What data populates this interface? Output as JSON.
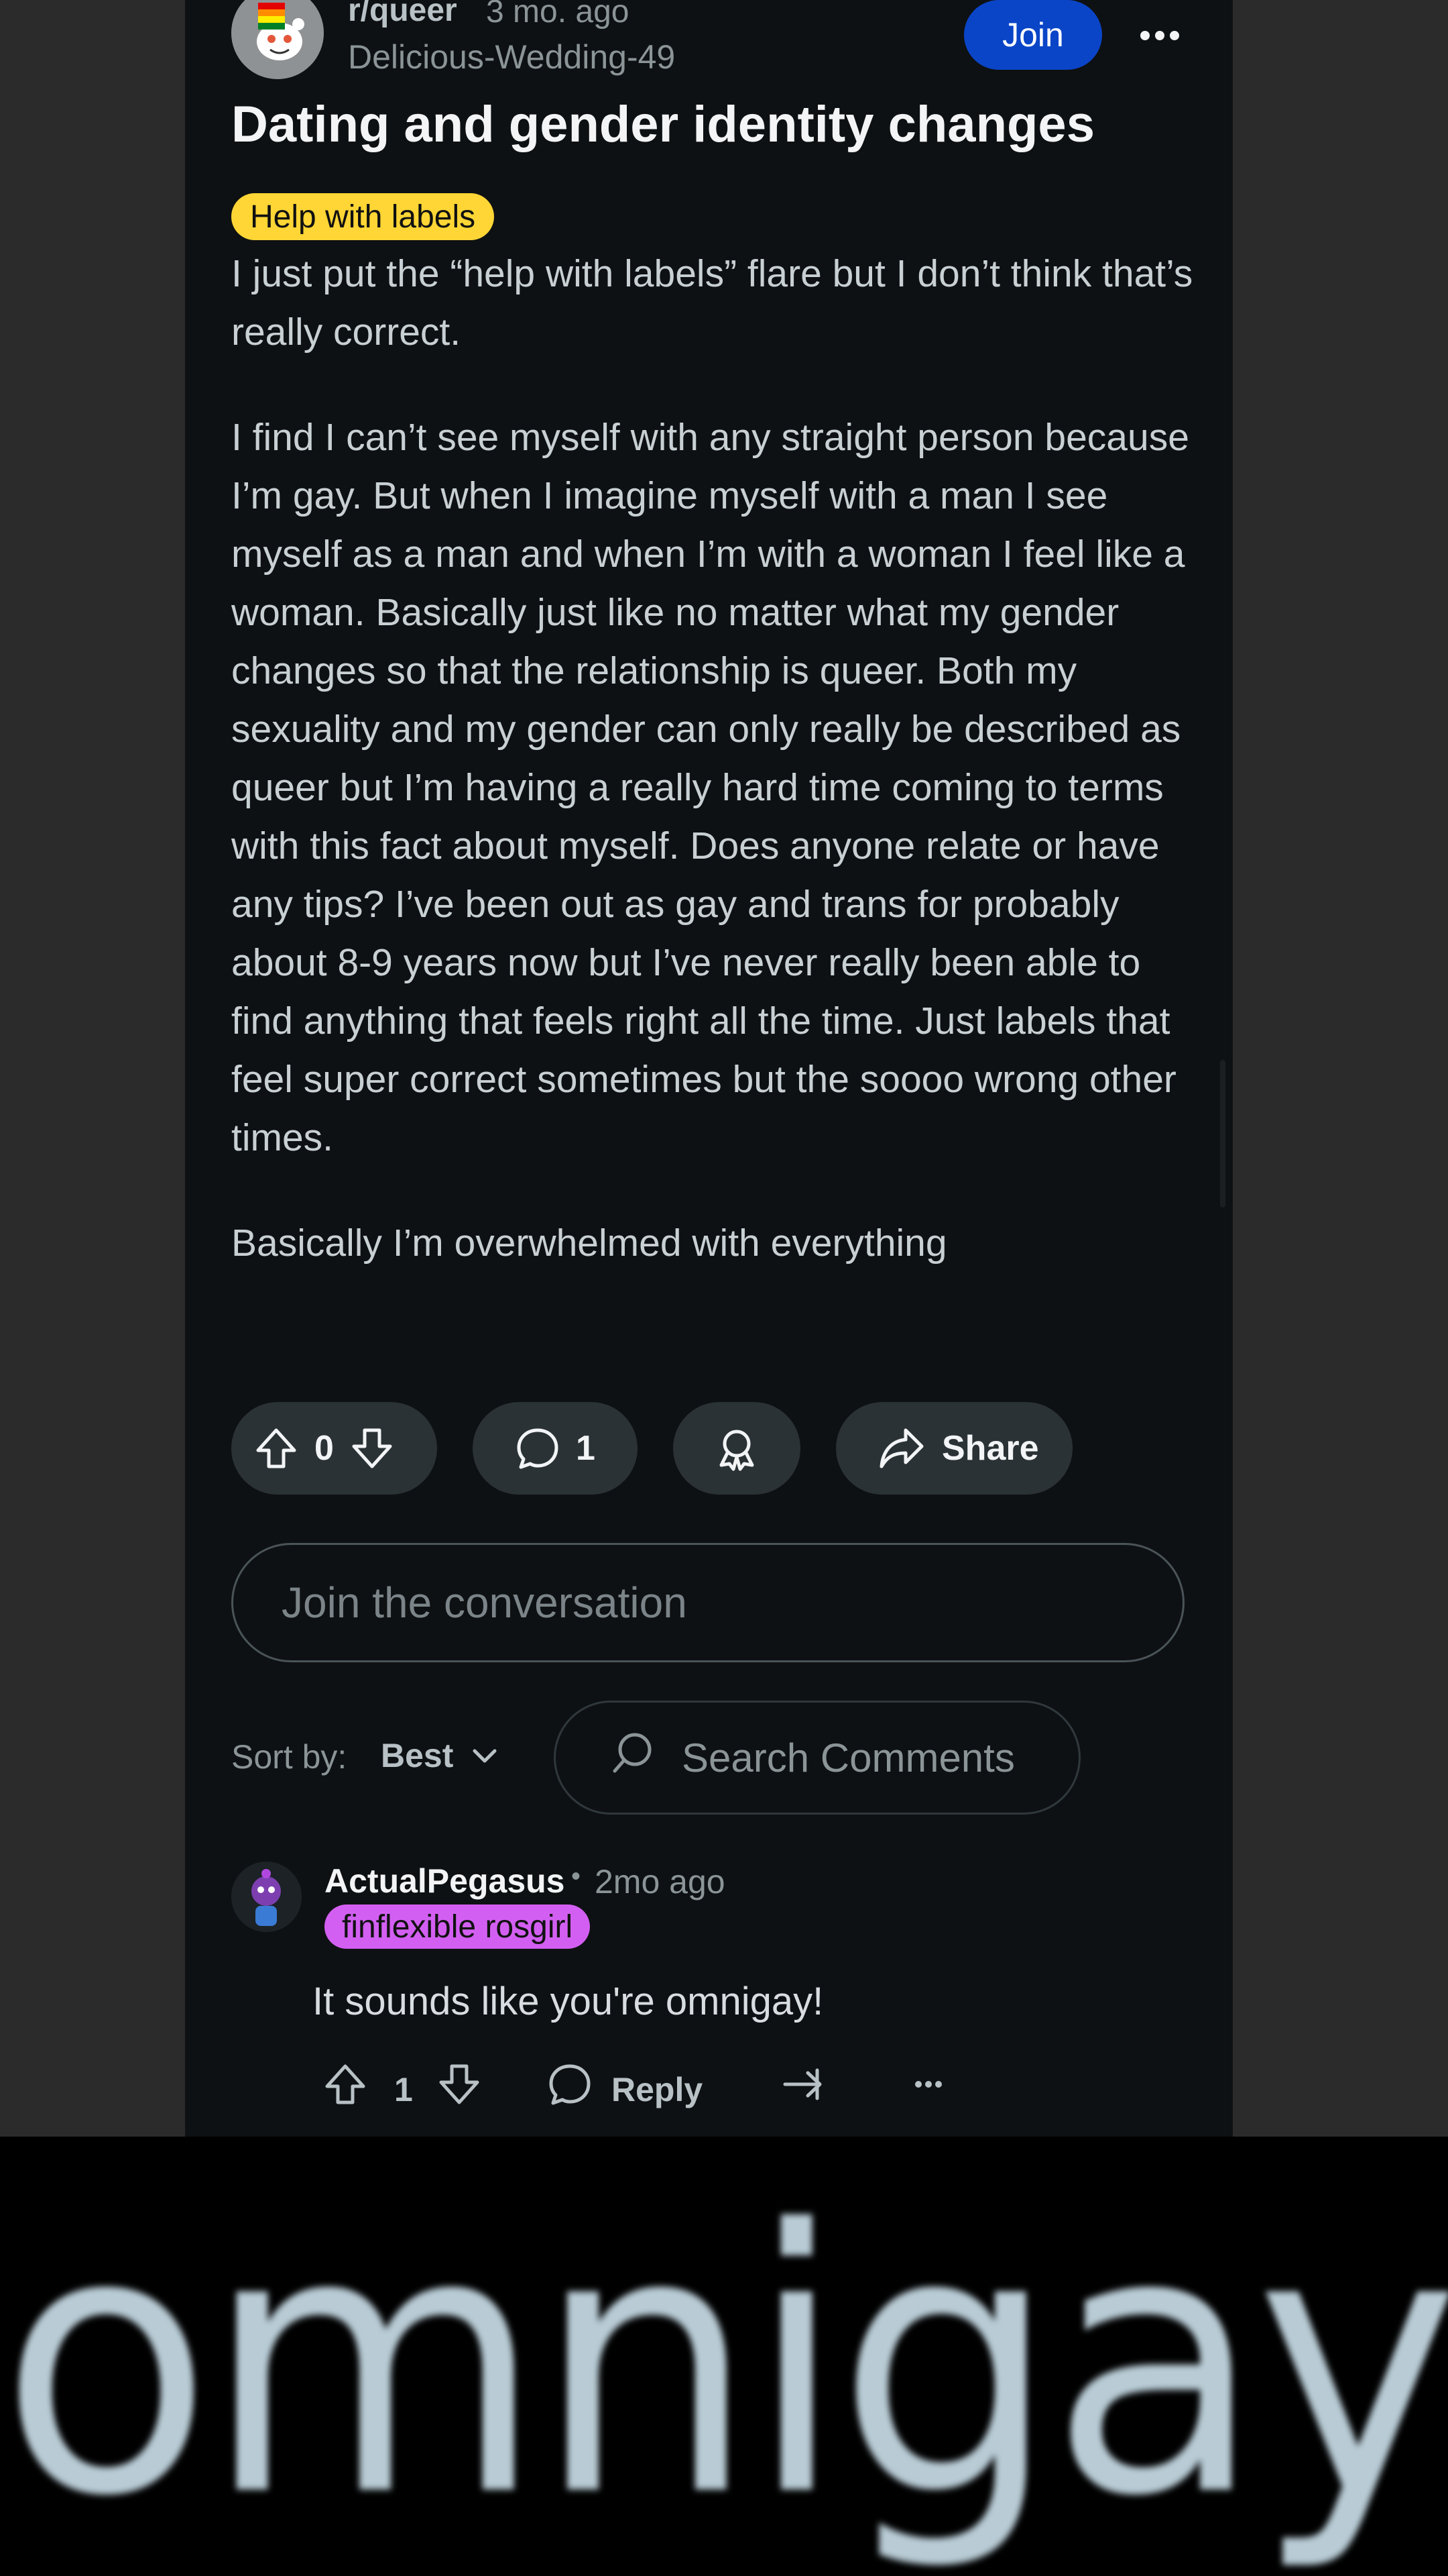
{
  "post": {
    "subreddit": "r/queer",
    "time": "3 mo. ago",
    "author": "Delicious-Wedding-49",
    "join_label": "Join",
    "title": "Dating and gender identity changes",
    "flair": "Help with labels",
    "paragraphs": [
      "I just put the “help with labels” flare but I don’t think that’s really correct.",
      "I find I can’t see myself with any straight person because I’m gay. But when I imagine myself with a man I see myself as a man and when I’m with a woman I feel like a woman. Basically just like no matter what my gender changes so that the relationship is queer. Both my sexuality and my gender can only really be described as queer but I’m having a really hard time coming to terms with this fact about myself. Does anyone relate or have any tips? I’ve been out as gay and trans for probably about 8-9 years now but I’ve never really been able to find anything that feels right all the time. Just labels that feel super correct sometimes but the soooo wrong other times.",
      "Basically I’m overwhelmed with everything"
    ],
    "votes": "0",
    "comments": "1",
    "share_label": "Share"
  },
  "composer": {
    "placeholder": "Join the conversation"
  },
  "sort": {
    "label": "Sort by:",
    "value": "Best"
  },
  "search": {
    "placeholder": "Search Comments"
  },
  "comment": {
    "author": "ActualPegasus",
    "separator": "•",
    "time": "2mo ago",
    "flair": "finflexible rosgirl",
    "text": "It sounds like you're omnigay!",
    "votes": "1",
    "reply_label": "Reply"
  },
  "banner": {
    "text": "omnigay!"
  },
  "colors": {
    "join_button": "#0a45c8",
    "post_flair": "#ffd635",
    "comment_flair": "#d35ff2",
    "panel_bg": "#0e1113"
  }
}
